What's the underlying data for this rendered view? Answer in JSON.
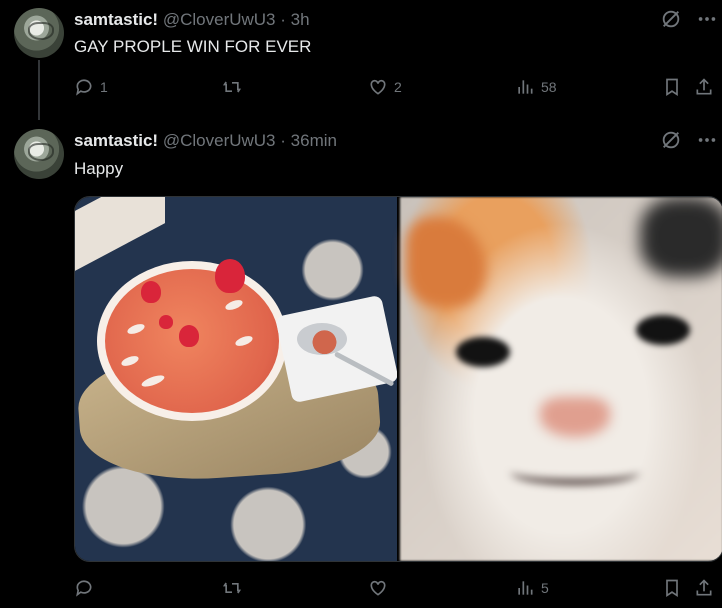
{
  "tweets": [
    {
      "display_name": "samtastic!",
      "handle": "@CloverUwU3",
      "time": "3h",
      "text": "GAY PROPLE WIN FOR EVER",
      "replies": "1",
      "reposts": "",
      "likes": "2",
      "views": "58"
    },
    {
      "display_name": "samtastic!",
      "handle": "@CloverUwU3",
      "time": "36min",
      "text": "Happy",
      "replies": "",
      "reposts": "",
      "likes": "",
      "views": "5"
    }
  ],
  "separator": "·",
  "icons": {
    "grok": "grok-icon",
    "more": "more-icon",
    "reply": "reply-icon",
    "repost": "repost-icon",
    "like": "like-icon",
    "views": "views-icon",
    "bookmark": "bookmark-icon",
    "share": "share-icon"
  },
  "colors": {
    "background": "#000000",
    "text": "#e7e9ea",
    "muted": "#71767b",
    "border": "#2f3336"
  }
}
